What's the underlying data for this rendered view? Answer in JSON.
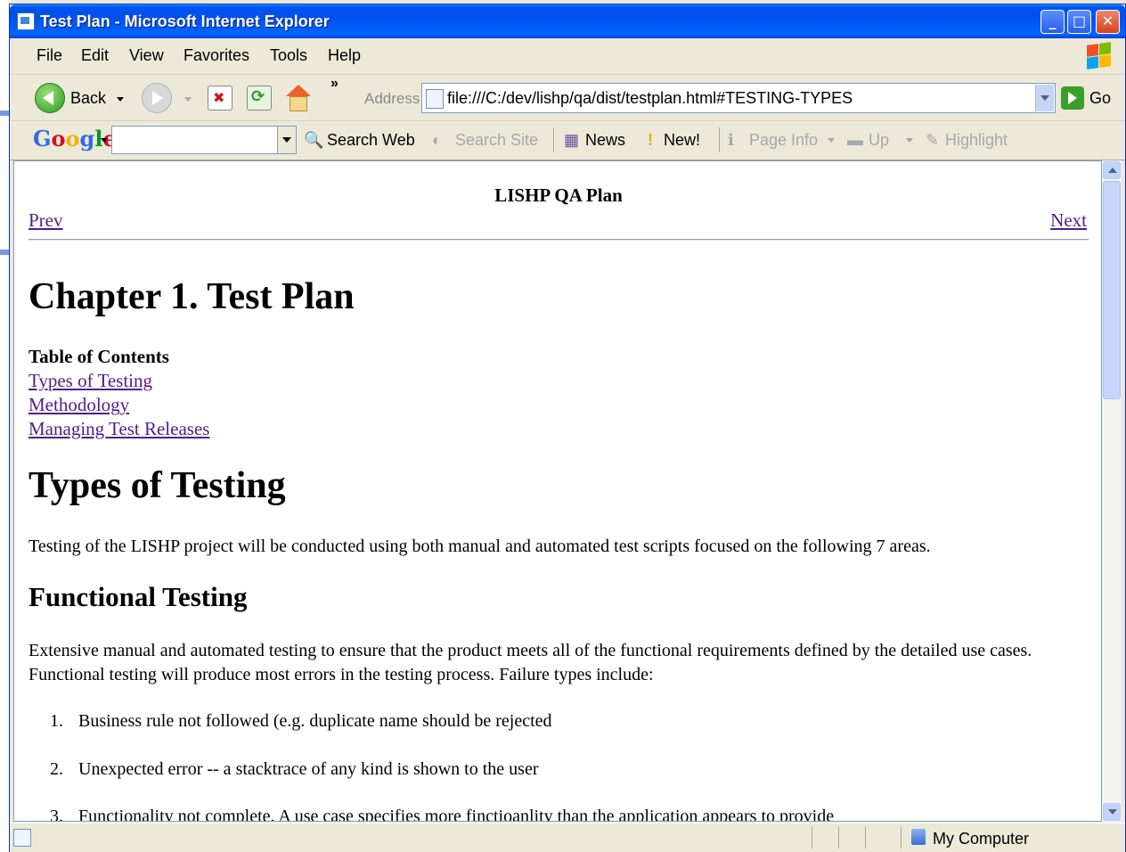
{
  "window": {
    "title": "Test Plan - Microsoft Internet Explorer",
    "controls": {
      "minimize": "_",
      "maximize": "□",
      "close": "✕"
    }
  },
  "menu": [
    "File",
    "Edit",
    "View",
    "Favorites",
    "Tools",
    "Help"
  ],
  "toolbar": {
    "back_label": "Back",
    "overflow": "»",
    "address_label": "Address",
    "address_value": "file:///C:/dev/lishp/qa/dist/testplan.html#TESTING-TYPES",
    "go_label": "Go"
  },
  "google_toolbar": {
    "logo": "Google",
    "search_value": "",
    "items": {
      "search_web": "Search Web",
      "search_site": "Search Site",
      "news": "News",
      "new": "New!",
      "page_info": "Page Info",
      "up": "Up",
      "highlight": "Highlight"
    }
  },
  "page": {
    "header_title": "LISHP QA Plan",
    "prev": "Prev",
    "next": "Next",
    "chapter_title": "Chapter 1. Test Plan",
    "toc_title": "Table of Contents",
    "toc": [
      "Types of Testing",
      "Methodology",
      "Managing Test Releases"
    ],
    "section_title": "Types of Testing",
    "section_intro": "Testing of the LISHP project will be conducted using both manual and automated test scripts focused on the following 7 areas.",
    "subsection_title": "Functional Testing",
    "subsection_para": "Extensive manual and automated testing to ensure that the product meets all of the functional requirements defined by the detailed use cases. Functional testing will produce most errors in the testing process. Failure types include:",
    "failures": [
      {
        "num": "1.",
        "text": "Business rule not followed (e.g. duplicate name should be rejected"
      },
      {
        "num": "2.",
        "text": "Unexpected error -- a stacktrace of any kind is shown to the user"
      },
      {
        "num": "3.",
        "text": "Functionality not complete. A use case specifies more finctioanlity than the application appears to provide"
      }
    ]
  },
  "status": {
    "zone": "My Computer"
  },
  "colors": {
    "titlebar": "#0053ee",
    "link_visited": "#551a8b",
    "chrome": "#ece9d8"
  }
}
